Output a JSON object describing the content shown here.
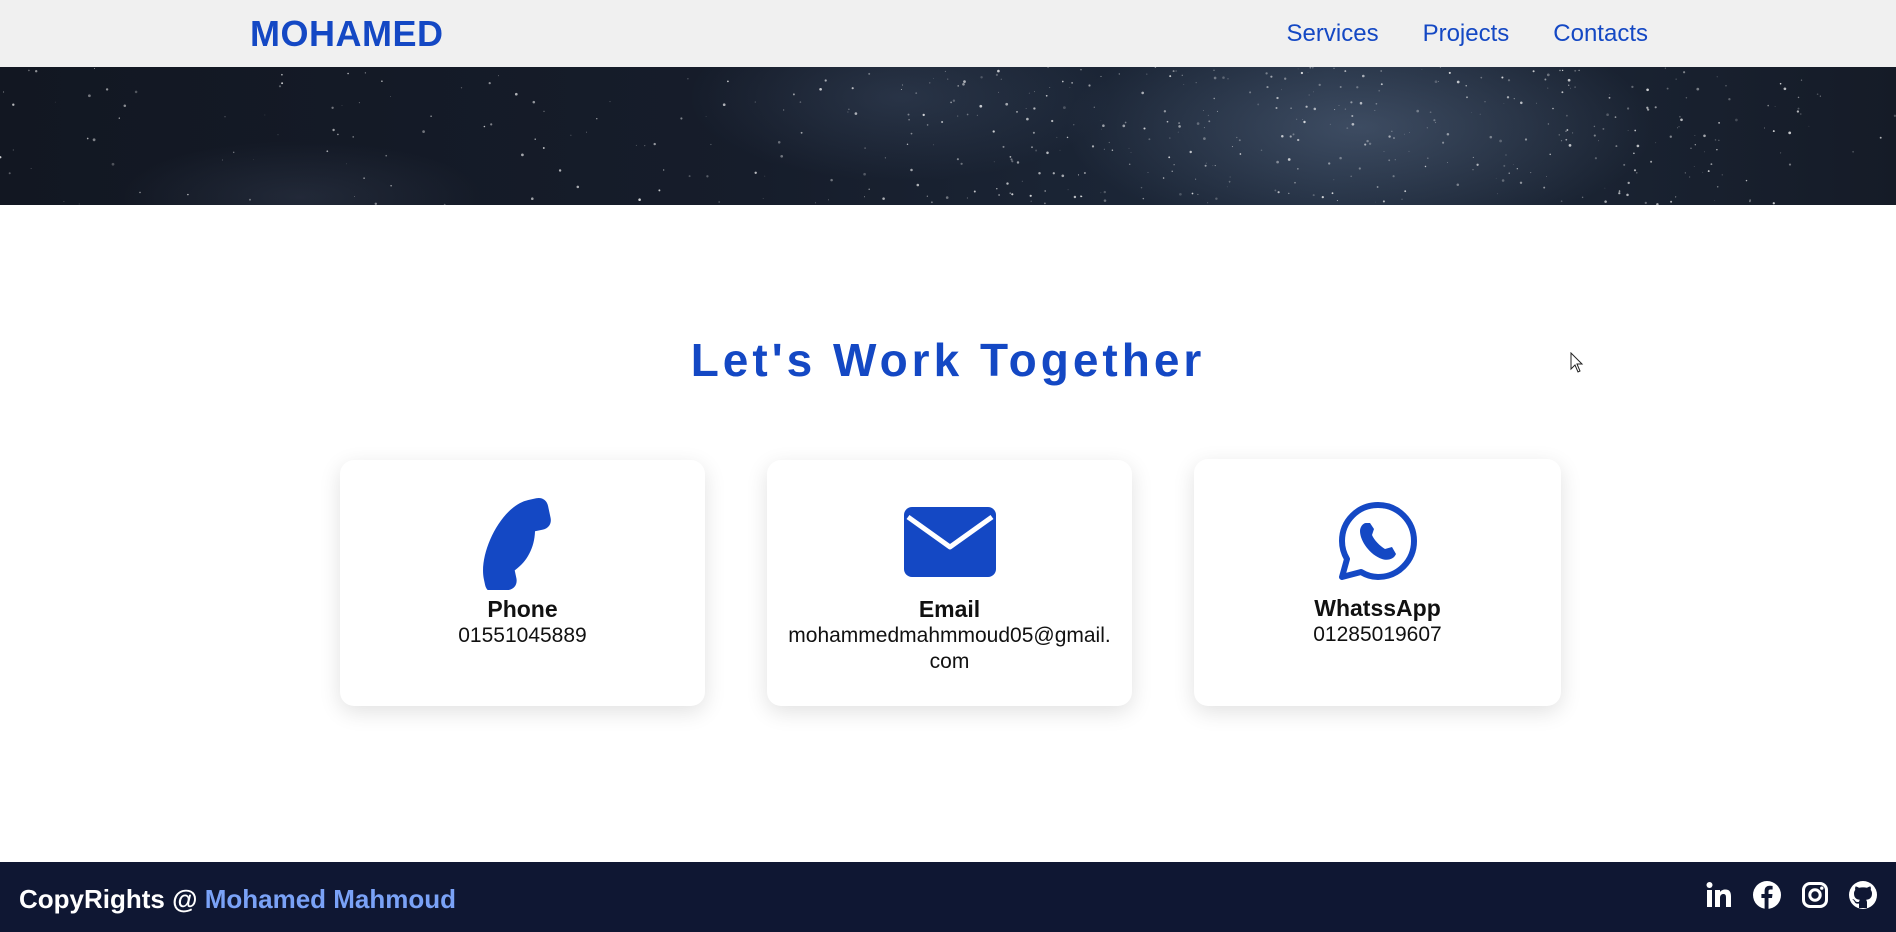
{
  "header": {
    "logo": "MOHAMED",
    "nav": [
      {
        "label": "Services"
      },
      {
        "label": "Projects"
      },
      {
        "label": "Contacts"
      }
    ]
  },
  "contact": {
    "title": "Let's Work Together",
    "cards": [
      {
        "icon": "phone-icon",
        "label": "Phone",
        "value": "01551045889"
      },
      {
        "icon": "email-icon",
        "label": "Email",
        "value": "mohammedmahmmoud05@gmail.com"
      },
      {
        "icon": "whatsapp-icon",
        "label": "WhatssApp",
        "value": "01285019607"
      }
    ]
  },
  "footer": {
    "copyright_prefix": "CopyRights @ ",
    "copyright_name": "Mohamed Mahmoud",
    "social": [
      "linkedin-icon",
      "facebook-icon",
      "instagram-icon",
      "github-icon"
    ]
  },
  "colors": {
    "accent": "#1448c4",
    "navbar_bg": "#f0f0f0",
    "footer_bg": "#0f1733",
    "footer_name": "#7aa2f7"
  }
}
